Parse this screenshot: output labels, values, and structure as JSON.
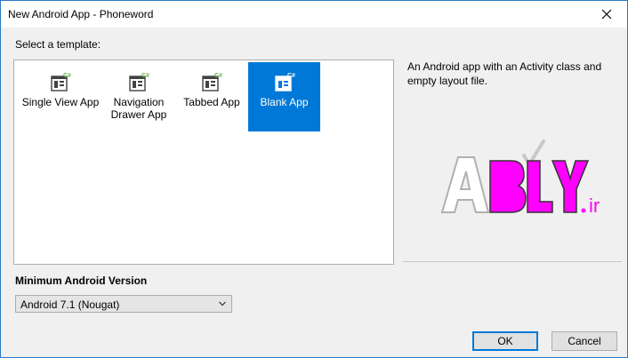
{
  "window": {
    "title": "New Android App - Phoneword",
    "close_icon": "close-icon"
  },
  "templates": {
    "label": "Select a template:",
    "items": [
      {
        "label": "Single View App",
        "icon": "csharp-template-icon",
        "selected": false
      },
      {
        "label": "Navigation\nDrawer App",
        "icon": "csharp-template-icon",
        "selected": false
      },
      {
        "label": "Tabbed App",
        "icon": "csharp-template-icon",
        "selected": false
      },
      {
        "label": "Blank App",
        "icon": "csharp-template-icon",
        "selected": true
      }
    ]
  },
  "description": {
    "text": "An Android app with an Activity class and empty layout file."
  },
  "watermark": {
    "text": "ABLY.ir"
  },
  "min_version": {
    "label": "Minimum Android Version",
    "selected": "Android 7.1 (Nougat)"
  },
  "buttons": {
    "ok": "OK",
    "cancel": "Cancel"
  },
  "colors": {
    "selection": "#0078d7",
    "csharp_badge": "#68b24b",
    "logo_magenta": "#ff00ff"
  }
}
